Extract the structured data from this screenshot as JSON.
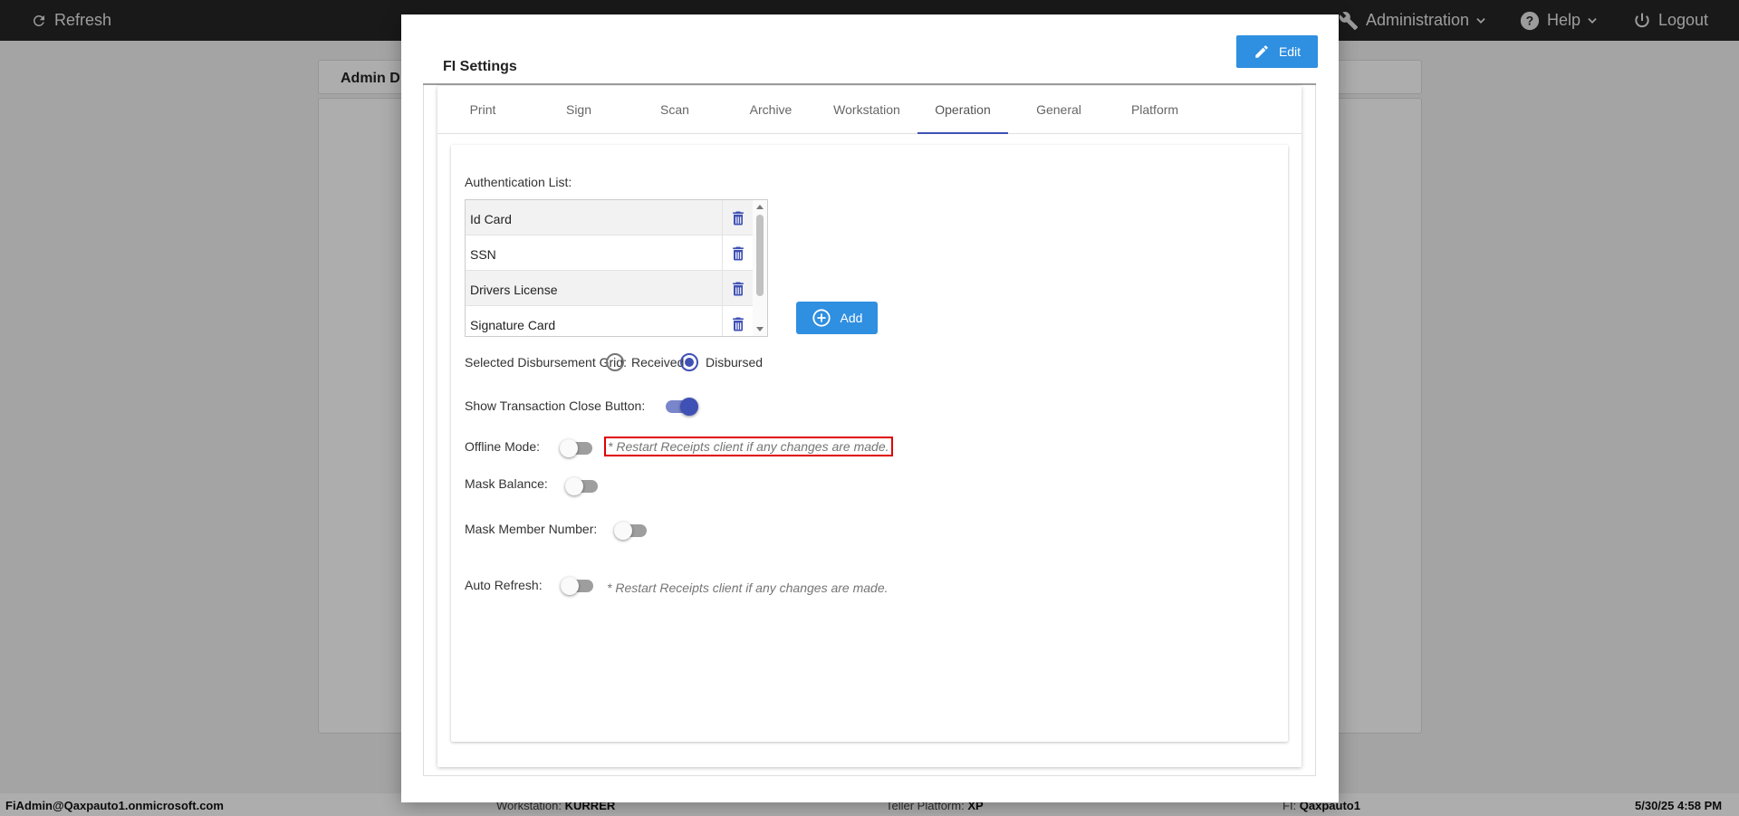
{
  "topbar": {
    "refresh_label": "Refresh",
    "administration_label": "Administration",
    "help_label": "Help",
    "logout_label": "Logout"
  },
  "background": {
    "tab_label": "Admin D"
  },
  "statusbar": {
    "user": "FiAdmin@Qaxpauto1.onmicrosoft.com",
    "workstation_label": "Workstation:",
    "workstation_value": "KURRER",
    "platform_label": "Teller Platform:",
    "platform_value": "XP",
    "fi_label": "FI:",
    "fi_value": "Qaxpauto1",
    "datetime": "5/30/25 4:58 PM"
  },
  "modal": {
    "title": "FI Settings",
    "edit_label": "Edit",
    "tabs": [
      {
        "label": "Print"
      },
      {
        "label": "Sign"
      },
      {
        "label": "Scan"
      },
      {
        "label": "Archive"
      },
      {
        "label": "Workstation"
      },
      {
        "label": "Operation",
        "active": true
      },
      {
        "label": "General"
      },
      {
        "label": "Platform"
      }
    ],
    "operation": {
      "auth_list_label": "Authentication List:",
      "auth_items": [
        "Id Card",
        "SSN",
        "Drivers License",
        "Signature Card"
      ],
      "add_label": "Add",
      "disbursement_label": "Selected Disbursement Grid:",
      "disbursement_options": [
        "Received",
        "Disbursed"
      ],
      "disbursement_selected": "Disbursed",
      "show_close_label": "Show Transaction Close Button:",
      "show_close_on": true,
      "offline_label": "Offline Mode:",
      "offline_on": false,
      "offline_note": "* Restart Receipts client if any changes are made.",
      "mask_balance_label": "Mask Balance:",
      "mask_balance_on": false,
      "mask_member_label": "Mask Member Number:",
      "mask_member_on": false,
      "auto_refresh_label": "Auto Refresh:",
      "auto_refresh_on": false,
      "auto_refresh_note": "* Restart Receipts client if any changes are made."
    }
  },
  "colors": {
    "primary_blue": "#2f8fe0",
    "indigo": "#3f51b5",
    "highlight_red": "#e00000"
  }
}
